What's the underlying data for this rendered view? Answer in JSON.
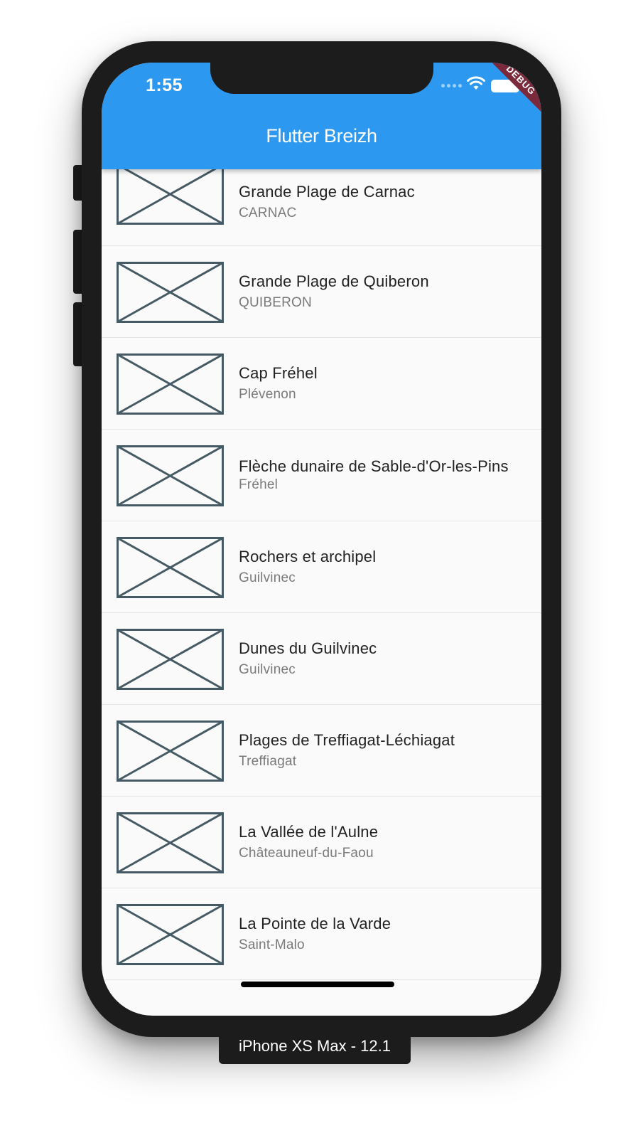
{
  "status_bar": {
    "time": "1:55",
    "icons": [
      "signal-dots-icon",
      "wifi-icon",
      "battery-icon"
    ]
  },
  "debug_banner": "DEBUG",
  "app_bar": {
    "title": "Flutter Breizh",
    "color": "#2c98f0"
  },
  "list": {
    "items": [
      {
        "title": "Grande Plage de Carnac",
        "subtitle": "CARNAC"
      },
      {
        "title": "Grande Plage de Quiberon",
        "subtitle": "QUIBERON"
      },
      {
        "title": "Cap Fréhel",
        "subtitle": "Plévenon"
      },
      {
        "title": "Flèche dunaire de Sable-d'Or-les-Pins",
        "subtitle": "Fréhel"
      },
      {
        "title": "Rochers et archipel",
        "subtitle": "Guilvinec"
      },
      {
        "title": "Dunes du Guilvinec",
        "subtitle": "Guilvinec"
      },
      {
        "title": "Plages de Treffiagat-Léchiagat",
        "subtitle": "Treffiagat"
      },
      {
        "title": "La Vallée de l'Aulne",
        "subtitle": "Châteauneuf-du-Faou"
      },
      {
        "title": "La Pointe de la Varde",
        "subtitle": "Saint-Malo"
      }
    ],
    "thumbnail_icon": "image-placeholder-icon"
  },
  "device_label": "iPhone XS Max - 12.1"
}
